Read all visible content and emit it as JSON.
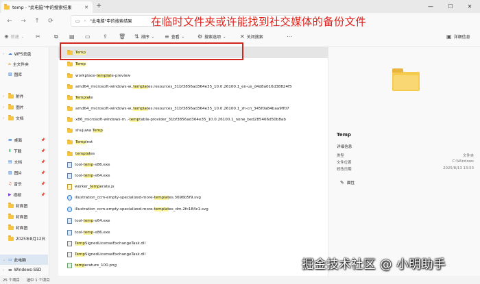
{
  "window": {
    "tab_title": "temp - \"此电脑\"中的搜索结果",
    "new_tab": "+",
    "address": "\"此电脑\"中的搜索结果",
    "min": "—",
    "max": "☐",
    "close": "✕"
  },
  "annotation": "在临时文件夹或许能找到社交媒体的备份文件",
  "toolbar": {
    "new": "新建",
    "sort": "排序",
    "view": "查看",
    "search_options": "搜索选项",
    "close_search": "关闭搜索",
    "details": "详细信息"
  },
  "sidebar": {
    "items": [
      {
        "label": "WPS云盘"
      },
      {
        "label": "主文件夹"
      },
      {
        "label": "图库"
      },
      {
        "label": "附件"
      },
      {
        "label": "图片"
      },
      {
        "label": "文档"
      },
      {
        "label": "桌面"
      },
      {
        "label": "下载"
      },
      {
        "label": "文档"
      },
      {
        "label": "图片"
      },
      {
        "label": "音乐"
      },
      {
        "label": "视频"
      },
      {
        "label": "封面图"
      },
      {
        "label": "封面图"
      },
      {
        "label": "封面图"
      },
      {
        "label": "2025年8月12日"
      },
      {
        "label": "此电脑"
      },
      {
        "label": "Windows-SSD"
      }
    ]
  },
  "files": [
    {
      "pre": "",
      "hl": "Temp",
      "post": "",
      "type": "folder"
    },
    {
      "pre": "",
      "hl": "Temp",
      "post": "",
      "type": "folder"
    },
    {
      "pre": "workplace-",
      "hl": "templat",
      "post": "e-preview",
      "type": "folder"
    },
    {
      "pre": "amd64_microsoft-windows-w..",
      "hl": "templat",
      "post": "es.resources_31bf3856ad364e35_10.0.26100.1_en-us_d4d8a016d38824f5",
      "type": "folder"
    },
    {
      "pre": "",
      "hl": "Templat",
      "post": "e",
      "type": "folder"
    },
    {
      "pre": "amd64_microsoft-windows-w..",
      "hl": "templat",
      "post": "es.resources_31bf3856ad364e35_10.0.26100.1_zh-cn_345f0a84baa9ff07",
      "type": "folder"
    },
    {
      "pre": "x86_microsoft-windows-m..-",
      "hl": "temp",
      "post": "table-provider_31bf3856ad364e35_10.0.26100.1_none_bed285466d50b8ab",
      "type": "folder"
    },
    {
      "pre": "shujuwa ",
      "hl": "Temp",
      "post": "",
      "type": "folder"
    },
    {
      "pre": "",
      "hl": "Temp",
      "post": "Inst",
      "type": "folder"
    },
    {
      "pre": "",
      "hl": "templat",
      "post": "es",
      "type": "folder"
    },
    {
      "pre": "tool-",
      "hl": "temp",
      "post": "-x86.exe",
      "type": "exe"
    },
    {
      "pre": "tool-",
      "hl": "temp",
      "post": "-x64.exe",
      "type": "exe"
    },
    {
      "pre": "worker_",
      "hl": "temp",
      "post": "erate.js",
      "type": "js"
    },
    {
      "pre": "illustration_ccm-empty-specialized-more-",
      "hl": "templat",
      "post": "es.3696b5f9.svg",
      "type": "svg"
    },
    {
      "pre": "illustration_ccm-empty-specialized-more-",
      "hl": "templat",
      "post": "es_dm.2fc184c1.svg",
      "type": "svg"
    },
    {
      "pre": "tool-",
      "hl": "temp",
      "post": "-x64.exe",
      "type": "exe"
    },
    {
      "pre": "tool-",
      "hl": "temp",
      "post": "-x86.exe",
      "type": "exe"
    },
    {
      "pre": "",
      "hl": "Temp",
      "post": "SignedLicenseExchangeTask.dll",
      "type": "dll"
    },
    {
      "pre": "",
      "hl": "Temp",
      "post": "SignedLicenseExchangeTask.dll",
      "type": "dll"
    },
    {
      "pre": "",
      "hl": "temp",
      "post": "erature_100.png",
      "type": "png"
    }
  ],
  "details_pane": {
    "name": "Temp",
    "section": "详细信息",
    "type_label": "类型",
    "type_value": "文件夹",
    "location_label": "文件位置",
    "location_value": "C:\\Windows",
    "modified_label": "修改日期",
    "modified_value": "2025/8/13 13:53",
    "properties": "属性"
  },
  "status": {
    "count": "25 个项目",
    "selected": "选中 1 个项目"
  },
  "watermark": "掘金技术社区 @ 小明助手"
}
